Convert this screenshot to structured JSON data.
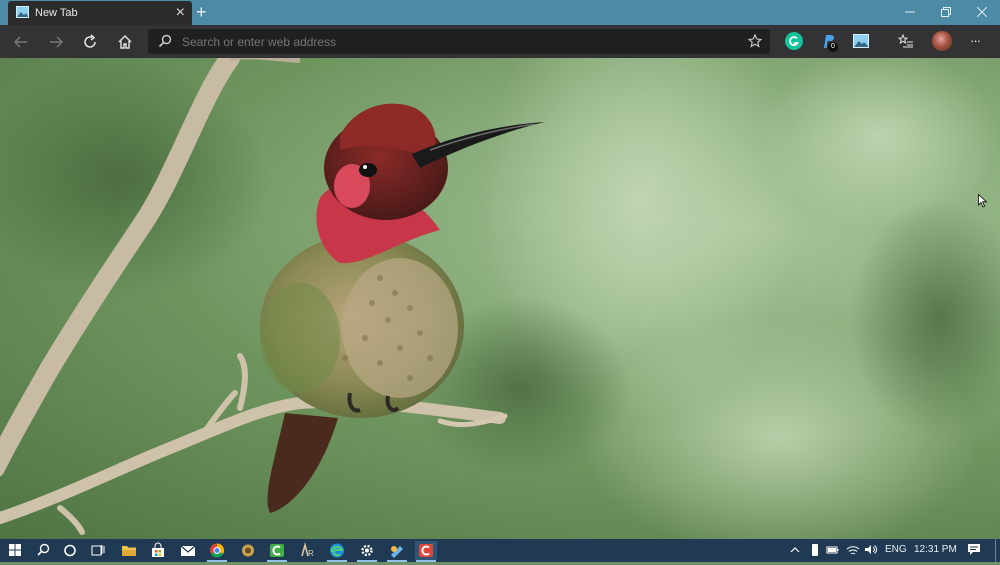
{
  "browser": {
    "tab_title": "New Tab",
    "tab_close": "×",
    "new_tab": "+",
    "address_placeholder": "Search or enter web address",
    "extension_badge": "0",
    "more": "···"
  },
  "taskbar": {
    "language": "ENG",
    "clock": "12:31 PM"
  },
  "colors": {
    "titlebar": "#4d8aa6",
    "toolbar": "#333336",
    "taskbar": "#1f3a52"
  }
}
